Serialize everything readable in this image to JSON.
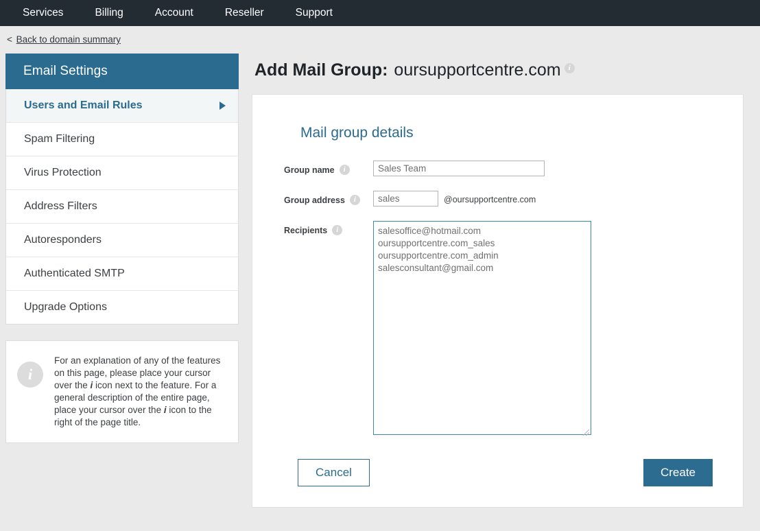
{
  "topnav": {
    "items": [
      {
        "label": "Services"
      },
      {
        "label": "Billing"
      },
      {
        "label": "Account"
      },
      {
        "label": "Reseller"
      },
      {
        "label": "Support"
      }
    ]
  },
  "backlink": {
    "chevron": "<",
    "label": "Back to domain summary"
  },
  "sidebar": {
    "header": "Email Settings",
    "items": [
      {
        "label": "Users and Email Rules",
        "active": true,
        "caret": true
      },
      {
        "label": "Spam Filtering",
        "active": false,
        "caret": false
      },
      {
        "label": "Virus Protection",
        "active": false,
        "caret": false
      },
      {
        "label": "Address Filters",
        "active": false,
        "caret": false
      },
      {
        "label": "Autoresponders",
        "active": false,
        "caret": false
      },
      {
        "label": "Authenticated SMTP",
        "active": false,
        "caret": false
      },
      {
        "label": "Upgrade Options",
        "active": false,
        "caret": false
      }
    ],
    "info_box": {
      "icon": "info-icon",
      "text_part_1": "For an explanation of any of the features on this page, please place your cursor over the ",
      "italic_1": "i",
      "text_part_2": " icon next to the feature. For a general description of the entire page, place your cursor over the ",
      "italic_2": "i",
      "text_part_3": " icon to the right of the page title."
    }
  },
  "page": {
    "title_prefix": "Add Mail Group:",
    "title_domain": "oursupportcentre.com",
    "title_info_icon": "info-icon",
    "panel_title": "Mail group details"
  },
  "form": {
    "group_name": {
      "label": "Group name",
      "info_icon": "info-icon",
      "value": "Sales Team",
      "placeholder": "Sales Team"
    },
    "group_address": {
      "label": "Group address",
      "info_icon": "info-icon",
      "value": "sales",
      "placeholder": "sales",
      "suffix": "@oursupportcentre.com"
    },
    "recipients": {
      "label": "Recipients",
      "info_icon": "info-icon",
      "value": "salesoffice@hotmail.com\noursupportcentre.com_sales\noursupportcentre.com_admin\nsalesconsultant@gmail.com",
      "lines": [
        "salesoffice@hotmail.com",
        "oursupportcentre.com_sales",
        "oursupportcentre.com_admin",
        "salesconsultant@gmail.com"
      ]
    }
  },
  "buttons": {
    "cancel": "Cancel",
    "create": "Create"
  },
  "colors": {
    "topnav_bg": "#232b33",
    "accent_blue": "#2a6b8f",
    "create_button": "#2d6c91",
    "page_bg": "#eaeaea",
    "textarea_border": "#3b8ba5"
  }
}
